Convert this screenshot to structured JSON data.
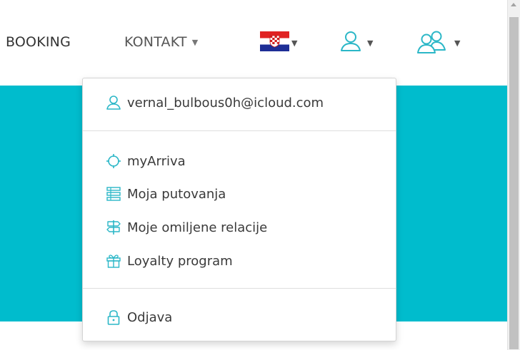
{
  "nav": {
    "booking_label": "BOOKING",
    "kontakt_label": "KONTAKT",
    "language": "Hrvatski"
  },
  "user_menu": {
    "email": "vernal_bulbous0h@icloud.com",
    "items": [
      {
        "label": "myArriva",
        "icon": "crosshair-icon"
      },
      {
        "label": "Moja putovanja",
        "icon": "list-icon"
      },
      {
        "label": "Moje omiljene relacije",
        "icon": "signpost-icon"
      },
      {
        "label": "Loyalty program",
        "icon": "gift-icon"
      }
    ],
    "logout_label": "Odjava"
  },
  "colors": {
    "accent": "#00bccd",
    "icon": "#2bb7c7",
    "text": "#3a3a3a"
  }
}
